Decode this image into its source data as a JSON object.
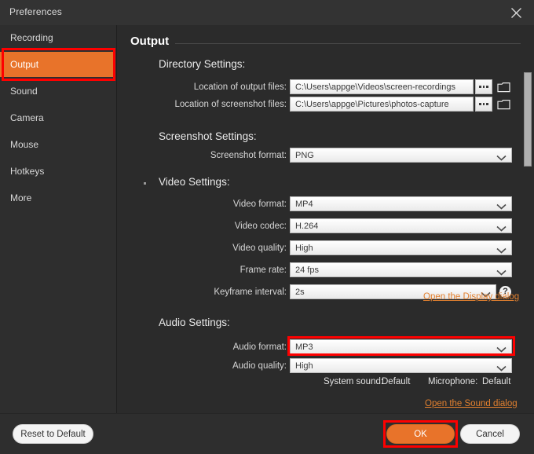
{
  "window": {
    "title": "Preferences",
    "close_icon": "close-icon"
  },
  "sidebar": {
    "items": [
      {
        "label": "Recording",
        "active": false
      },
      {
        "label": "Output",
        "active": true
      },
      {
        "label": "Sound",
        "active": false
      },
      {
        "label": "Camera",
        "active": false
      },
      {
        "label": "Mouse",
        "active": false
      },
      {
        "label": "Hotkeys",
        "active": false
      },
      {
        "label": "More",
        "active": false
      }
    ]
  },
  "panel": {
    "title": "Output",
    "groups": {
      "directory": {
        "title": "Directory Settings:",
        "output_files_label": "Location of output files:",
        "output_files_value": "C:\\Users\\appge\\Videos\\screen-recordings",
        "screenshot_files_label": "Location of screenshot files:",
        "screenshot_files_value": "C:\\Users\\appge\\Pictures\\photos-capture",
        "browse_icon": "ellipsis-icon",
        "folder_icon": "folder-icon"
      },
      "screenshot": {
        "title": "Screenshot Settings:",
        "format_label": "Screenshot format:",
        "format_value": "PNG"
      },
      "video": {
        "title": "Video Settings:",
        "format_label": "Video format:",
        "format_value": "MP4",
        "codec_label": "Video codec:",
        "codec_value": "H.264",
        "quality_label": "Video quality:",
        "quality_value": "High",
        "framerate_label": "Frame rate:",
        "framerate_value": "24 fps",
        "keyframe_label": "Keyframe interval:",
        "keyframe_value": "2s",
        "help_icon": "question-mark-icon",
        "display_link": "Open the Display dialog"
      },
      "audio": {
        "title": "Audio Settings:",
        "format_label": "Audio format:",
        "format_value": "MP3",
        "quality_label": "Audio quality:",
        "quality_value": "High",
        "system_sound_label": "System sound:",
        "system_sound_value": "Default",
        "microphone_label": "Microphone:",
        "microphone_value": "Default",
        "sound_link": "Open the Sound dialog"
      }
    }
  },
  "footer": {
    "reset_label": "Reset to Default",
    "ok_label": "OK",
    "cancel_label": "Cancel"
  },
  "colors": {
    "accent": "#e8732a",
    "highlight": "#fe0000",
    "window_bg": "#2b2b2b",
    "sidebar_bg": "#2e2e2e",
    "link": "#e2802f"
  }
}
